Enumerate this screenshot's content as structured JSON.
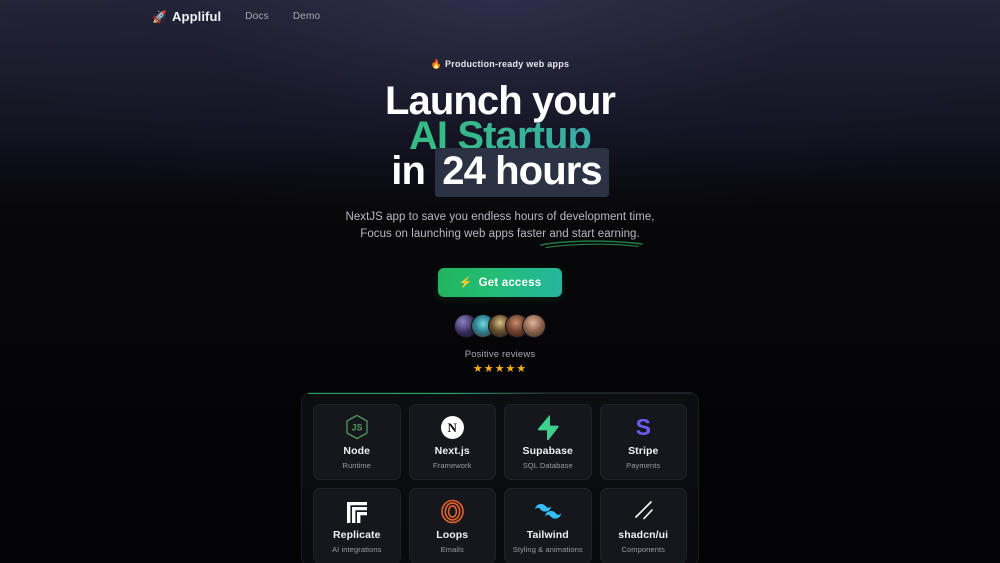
{
  "nav": {
    "brand": "Appliful",
    "brand_icon": "rocket-icon",
    "brand_emoji": "🚀",
    "links": [
      {
        "label": "Docs"
      },
      {
        "label": "Demo"
      }
    ]
  },
  "hero": {
    "badge_emoji": "🔥",
    "badge_text": "Production-ready web apps",
    "headline_line1": "Launch your",
    "headline_line2": "AI Startup",
    "headline_line3_pre": "in ",
    "headline_line3_mark": "24 hours",
    "subtitle_line1": "NextJS app to save you endless hours of development time,",
    "subtitle_line2_pre": "Focus on launching web apps faster and ",
    "subtitle_line2_underlined": "start earning.",
    "cta_label": "Get access",
    "cta_icon": "lightning-bolt-icon",
    "cta_glyph": "⚡",
    "gradient_start": "#22c55e",
    "gradient_end": "#4f9ff0",
    "highlight_bg": "#2b3243"
  },
  "social_proof": {
    "avatar_count": 5,
    "label": "Positive reviews",
    "stars": "★★★★★",
    "star_color": "#f5b018"
  },
  "stack": {
    "cards": [
      {
        "name": "Node",
        "subtitle": "Runtime",
        "icon": "nodejs-hexagon-icon",
        "color": "#4f9c5a"
      },
      {
        "name": "Next.js",
        "subtitle": "Framework",
        "icon": "nextjs-circle-icon",
        "color": "#ffffff"
      },
      {
        "name": "Supabase",
        "subtitle": "SQL Database",
        "icon": "supabase-bolt-icon",
        "color": "#3ecf8e"
      },
      {
        "name": "Stripe",
        "subtitle": "Payments",
        "icon": "stripe-s-icon",
        "color": "#6b5cf6"
      },
      {
        "name": "Replicate",
        "subtitle": "AI integrations",
        "icon": "replicate-bars-icon",
        "color": "#ffffff"
      },
      {
        "name": "Loops",
        "subtitle": "Emails",
        "icon": "loops-rings-icon",
        "color": "#e8622c"
      },
      {
        "name": "Tailwind",
        "subtitle": "Styling & animations",
        "icon": "tailwind-waves-icon",
        "color": "#38bdf8"
      },
      {
        "name": "shadcn/ui",
        "subtitle": "Components",
        "icon": "shadcn-slashes-icon",
        "color": "#ffffff"
      }
    ]
  }
}
